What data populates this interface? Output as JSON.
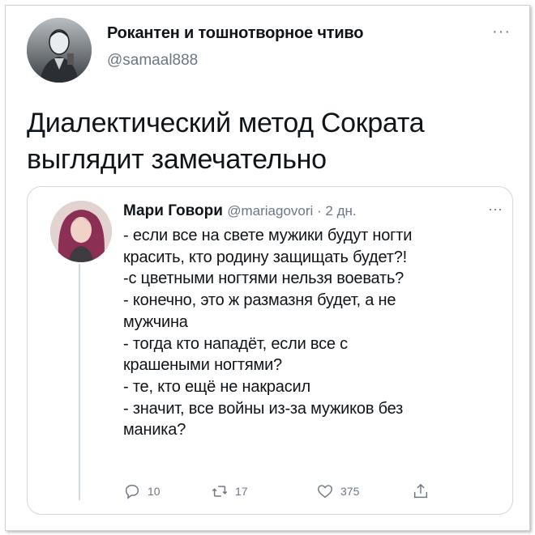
{
  "tweet": {
    "author_name": "Рокантен и тошнотворное чтиво",
    "author_handle": "@samaal888",
    "more_icon": "more-dots-icon",
    "text_lines": [
      "Диалектический метод Сократа",
      "выглядит замечательно"
    ]
  },
  "quote": {
    "author_name": "Мари Говори",
    "author_handle": "@mariagovori",
    "separator": " · ",
    "time": "2 дн.",
    "lines": [
      "- если все на свете мужики будут ногти",
      "красить, кто родину защищать будет?!",
      "-с цветными ногтями нельзя воевать?",
      "- конечно, это ж размазня будет, а не",
      "мужчина",
      "- тогда кто нападёт, если все с",
      "крашеными ногтями?",
      "- те, кто ещё не накрасил",
      "- значит, все войны из-за мужиков без",
      "маника?"
    ],
    "actions": {
      "reply_count": "10",
      "retweet_count": "17",
      "like_count": "375"
    }
  },
  "colors": {
    "text": "#0f1419",
    "secondary": "#6b7785",
    "border": "#cfd9de"
  }
}
